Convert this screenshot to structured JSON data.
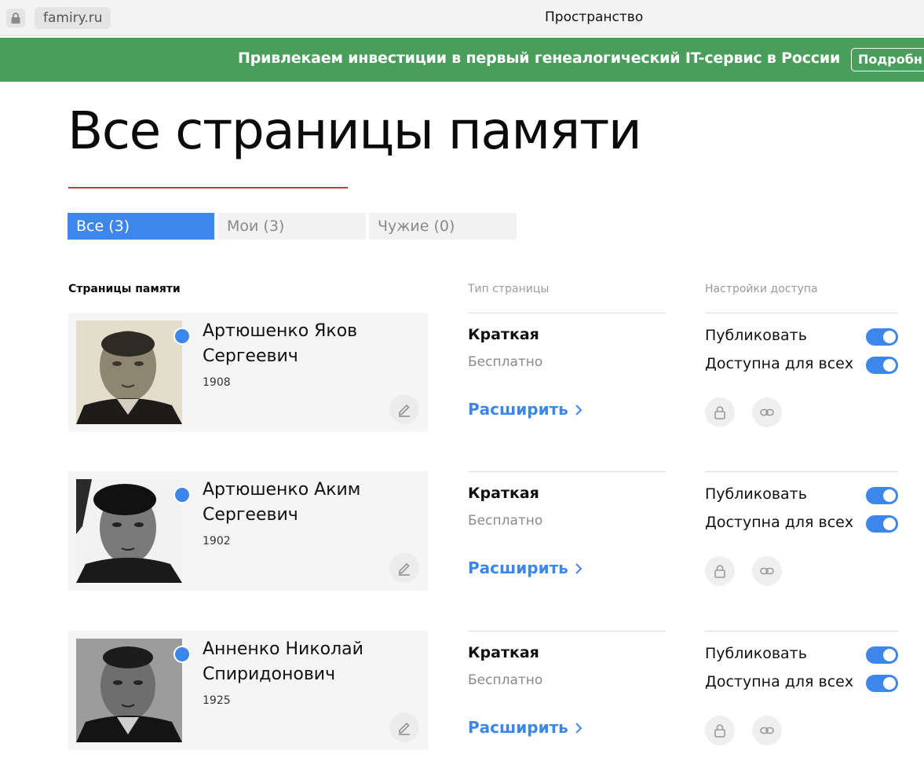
{
  "browser": {
    "domain": "famiry.ru",
    "tab_title": "Пространство"
  },
  "promo": {
    "text": "Привлекаем инвестиции в первый генеалогический IT-сервис в России",
    "button": "Подробн"
  },
  "page": {
    "title": "Все страницы памяти",
    "accent_color": "#c23a35"
  },
  "tabs": [
    {
      "label": "Все (3)",
      "active": true
    },
    {
      "label": "Мои (3)",
      "active": false
    },
    {
      "label": "Чужие (0)",
      "active": false
    }
  ],
  "columns": {
    "main": "Страницы памяти",
    "type": "Тип страницы",
    "access": "Настройки доступа"
  },
  "labels": {
    "publish": "Публиковать",
    "public_access": "Доступна для всех",
    "expand": "Расширить"
  },
  "rows": [
    {
      "name": "Артюшенко Яков Сергеевич",
      "year": "1908",
      "page_type": "Краткая",
      "price": "Бесплатно",
      "publish_on": true,
      "public_on": true
    },
    {
      "name": "Артюшенко Аким Сергеевич",
      "year": "1902",
      "page_type": "Краткая",
      "price": "Бесплатно",
      "publish_on": true,
      "public_on": true
    },
    {
      "name": "Анненко Николай Спиридонович",
      "year": "1925",
      "page_type": "Краткая",
      "price": "Бесплатно",
      "publish_on": true,
      "public_on": true
    }
  ],
  "colors": {
    "brand_blue": "#3d86ec",
    "promo_green": "#4a9e5c"
  }
}
